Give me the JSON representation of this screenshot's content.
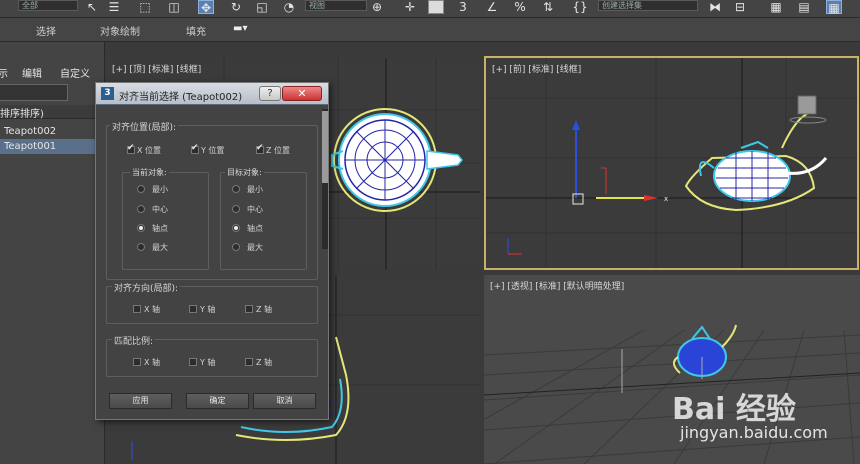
{
  "toolbar": {
    "field1": "全部",
    "field2": "视图",
    "field3": "创建选择集"
  },
  "tabs": [
    "选择",
    "对象绘制",
    "填充"
  ],
  "explorer": {
    "menus": [
      "示",
      "编辑",
      "自定义"
    ],
    "header": "排序排序)",
    "items": [
      {
        "label": "Teapot002",
        "selected": false
      },
      {
        "label": "Teapot001",
        "selected": true
      }
    ]
  },
  "viewports": {
    "top": "[+] [顶] [标准] [线框]",
    "front": "[+] [前] [标准] [线框]",
    "perspective": "[+] [透视] [标准] [默认明暗处理]"
  },
  "dialog": {
    "icon": "3",
    "title": "对齐当前选择 (Teapot002)",
    "help_label": "?",
    "close_label": "✕",
    "align_position": {
      "label": "对齐位置(局部):",
      "x": {
        "label": "X 位置",
        "checked": true
      },
      "y": {
        "label": "Y 位置",
        "checked": true
      },
      "z": {
        "label": "Z 位置",
        "checked": true
      }
    },
    "current_object": {
      "label": "当前对象:",
      "options": [
        "最小",
        "中心",
        "轴点",
        "最大"
      ],
      "selected": "轴点"
    },
    "target_object": {
      "label": "目标对象:",
      "options": [
        "最小",
        "中心",
        "轴点",
        "最大"
      ],
      "selected": "轴点"
    },
    "align_orientation": {
      "label": "对齐方向(局部):",
      "x": "X 轴",
      "y": "Y 轴",
      "z": "Z 轴"
    },
    "match_scale": {
      "label": "匹配比例:",
      "x": "X 轴",
      "y": "Y 轴",
      "z": "Z 轴"
    },
    "buttons": {
      "apply": "应用",
      "ok": "确定",
      "cancel": "取消"
    }
  },
  "watermark": {
    "brand": "Bai 经验",
    "url": "jingyan.baidu.com"
  },
  "colors": {
    "dialog_bg": "#434343",
    "viewport_bg": "#3b3b3b",
    "active_border": "#c8b26a",
    "selection": "#5a6f8a"
  }
}
